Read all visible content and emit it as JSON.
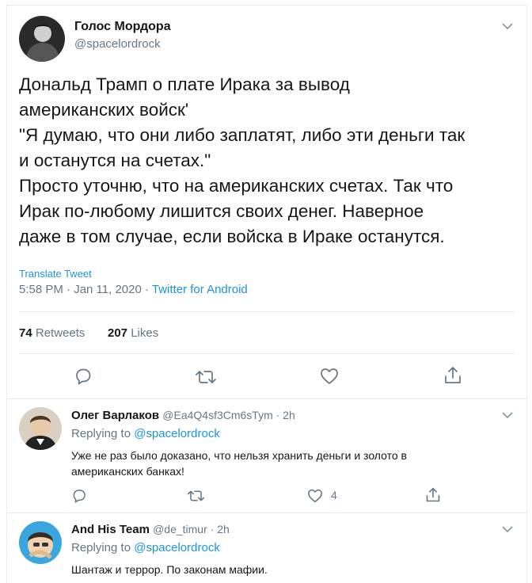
{
  "main_tweet": {
    "author_name": "Голос Мордора",
    "author_handle": "@spacelordrock",
    "text_lines": [
      "Дональд Трамп о плате Ирака за вывод",
      "американских войск'",
      "\"Я думаю, что они либо заплатят, либо эти деньги так",
      "и останутся на счетах.\"",
      "Просто уточню, что на американских счетах. Так что",
      "Ирак по-любому лишится своих денег. Наверное",
      "даже в том случае, если войска в Ираке останутся."
    ],
    "translate_label": "Translate Tweet",
    "timestamp": "5:58 PM · Jan 11, 2020 ·",
    "source": "Twitter for Android",
    "retweets_count": "74",
    "retweets_label": "Retweets",
    "likes_count": "207",
    "likes_label": "Likes"
  },
  "replies": [
    {
      "author_name": "Олег Варлаков",
      "author_handle": "@Ea4Q4sf3Cm6sTym · 2h",
      "replying_prefix": "Replying to",
      "replying_handle": "@spacelordrock",
      "text_lines": [
        "Уже не раз было доказано, что нельзя хранить деньги и золото в",
        "американских банках!"
      ],
      "like_count": "4"
    },
    {
      "author_name": "And His Team",
      "author_handle": "@de_timur · 2h",
      "replying_prefix": "Replying to",
      "replying_handle": "@spacelordrock",
      "text_lines": [
        "Шантаж и террор. По законам мафии."
      ]
    }
  ],
  "icons": {
    "menu": "chevron-down-icon",
    "reply": "reply-icon",
    "retweet": "retweet-icon",
    "like": "heart-icon",
    "share": "share-icon"
  },
  "colors": {
    "link": "#1b95e0",
    "muted": "#657786",
    "text": "#14171a",
    "divider": "#e6ecf0"
  }
}
